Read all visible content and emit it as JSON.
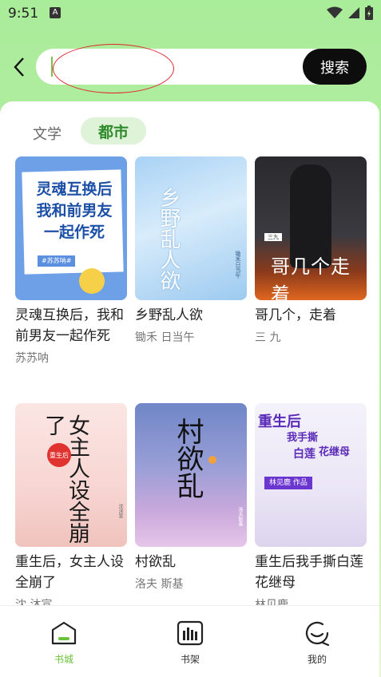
{
  "status": {
    "time": "9:51",
    "app_icon": "A"
  },
  "search": {
    "placeholder": "",
    "value": "",
    "button_label": "搜索"
  },
  "tabs": [
    {
      "label": "文学",
      "active": false
    },
    {
      "label": "都市",
      "active": true
    }
  ],
  "books": [
    {
      "title": "灵魂互换后，我和前男友一起作死",
      "author": "苏苏呐",
      "cover_text": [
        "灵魂互换后",
        "我和前男友",
        "一起作死"
      ],
      "cover_tag": "#苏苏呐#"
    },
    {
      "title": "乡野乱人欲",
      "author": "锄禾 日当午",
      "cover_text": "乡野乱人欲",
      "cover_side": "锄禾日当午"
    },
    {
      "title": "哥几个，走着",
      "author": "三 九",
      "cover_text": "哥几个走着",
      "cover_badge": "三九"
    },
    {
      "title": "重生后，女主人设全崩了",
      "author": "沈 沐宣",
      "cover_text": "女主人设全崩了",
      "cover_seal": "重生后",
      "cover_side": "沈沐宣"
    },
    {
      "title": "村欲乱",
      "author": "洛夫 斯基",
      "cover_text": "村欲乱",
      "cover_side": "洛夫斯基"
    },
    {
      "title": "重生后我手撕白莲花继母",
      "author": "林见鹿",
      "cover_text": [
        "重生后",
        "我手撕",
        "白莲",
        "花继母"
      ],
      "cover_tag": "林见鹿 作品"
    }
  ],
  "nav": [
    {
      "label": "书城",
      "icon": "home-icon",
      "active": true
    },
    {
      "label": "书架",
      "icon": "bookshelf-icon",
      "active": false
    },
    {
      "label": "我的",
      "icon": "profile-icon",
      "active": false
    }
  ],
  "colors": {
    "accent": "#6ac23a",
    "search_button": "#0d0d0d",
    "annotation": "#e0262b"
  }
}
